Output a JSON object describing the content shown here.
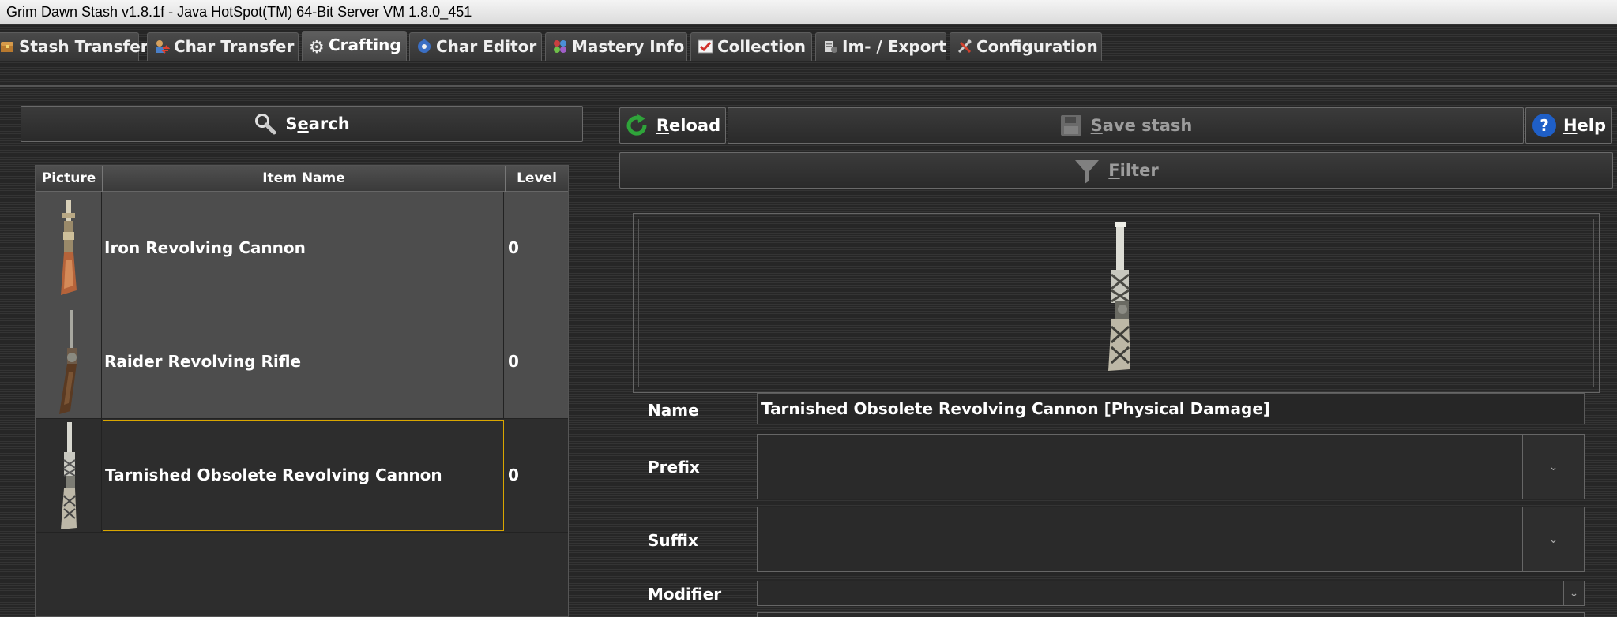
{
  "window": {
    "title": "Grim Dawn Stash v1.8.1f - Java HotSpot(TM) 64-Bit Server VM 1.8.0_451"
  },
  "tabs": [
    {
      "label": "Stash Transfer",
      "icon": "chest-icon"
    },
    {
      "label": "Char Transfer",
      "icon": "char-transfer-icon"
    },
    {
      "label": "Crafting",
      "icon": "gear-icon",
      "active": true
    },
    {
      "label": "Char Editor",
      "icon": "char-editor-icon"
    },
    {
      "label": "Mastery Info",
      "icon": "mastery-icon"
    },
    {
      "label": "Collection",
      "icon": "checklist-icon"
    },
    {
      "label": "Im- / Export",
      "icon": "import-export-icon"
    },
    {
      "label": "Configuration",
      "icon": "tools-icon"
    }
  ],
  "search": {
    "pre": "S",
    "mnemonic": "e",
    "post": "arch"
  },
  "table": {
    "headers": {
      "picture": "Picture",
      "name": "Item Name",
      "level": "Level"
    },
    "rows": [
      {
        "name": "Iron Revolving Cannon",
        "level": "0"
      },
      {
        "name": "Raider Revolving Rifle",
        "level": "0"
      },
      {
        "name": "Tarnished Obsolete Revolving Cannon",
        "level": "0",
        "selected": true
      }
    ]
  },
  "toolbar": {
    "reload": {
      "mnemonic": "R",
      "rest": "eload"
    },
    "save": {
      "mnemonic": "S",
      "rest": "ave stash",
      "enabled": false
    },
    "help": {
      "mnemonic": "H",
      "rest": "elp"
    },
    "filter": {
      "mnemonic": "F",
      "rest": "ilter"
    }
  },
  "details": {
    "name_label": "Name",
    "name_value": "Tarnished Obsolete Revolving Cannon [Physical Damage]",
    "prefix_label": "Prefix",
    "prefix_value": "",
    "suffix_label": "Suffix",
    "suffix_value": "",
    "modifier_label": "Modifier",
    "modifier_value": ""
  },
  "colors": {
    "selection_border": "#d9a600",
    "reload_green": "#2fa43a",
    "help_blue": "#1f5fc7"
  }
}
